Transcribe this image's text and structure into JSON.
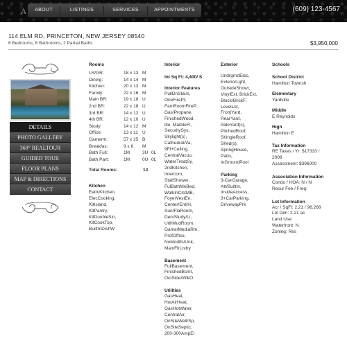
{
  "nav": {
    "logo": "A",
    "items": [
      "ABOUT",
      "LISTINGS",
      "SERVICES",
      "APPOINTMENTS"
    ],
    "phone": "(609) 123-4567"
  },
  "listing": {
    "address": "114 ELM RD, PRINCETON, NEW JERSEY 08540",
    "summary": "6 Bedrooms, 6 Bathrooms, 2 Partial Baths",
    "price": "$3,950,000"
  },
  "sidebar": {
    "items": [
      "DETAILS",
      "PHOTO GALLERY",
      "360° REALTOUR",
      "GUIDED TOUR",
      "FLOOR PLANS",
      "MAP & DIRECTIONS",
      "CONTACT"
    ],
    "active": "DETAILS"
  },
  "rooms": {
    "heading": "Rooms",
    "rows": [
      {
        "name": "LR/GR:",
        "size": "18 x 13",
        "level": "M",
        "extra": ""
      },
      {
        "name": "Dining:",
        "size": "14 x 14",
        "level": "M",
        "extra": ""
      },
      {
        "name": "Kitchen:",
        "size": "20 x 13",
        "level": "M",
        "extra": ""
      },
      {
        "name": "Family:",
        "size": "22 x 16",
        "level": "M",
        "extra": ""
      },
      {
        "name": "Main BR:",
        "size": "19 x 18",
        "level": "U",
        "extra": ""
      },
      {
        "name": "2nd BR:",
        "size": "22 x 18",
        "level": "U",
        "extra": ""
      },
      {
        "name": "3rd BR:",
        "size": "14 x 12",
        "level": "U",
        "extra": ""
      },
      {
        "name": "4th BR:",
        "size": "12 x 10",
        "level": "U",
        "extra": ""
      },
      {
        "name": "Study:",
        "size": "14 x 12",
        "level": "M",
        "extra": ""
      },
      {
        "name": "Office:",
        "size": "13 x 11",
        "level": "U",
        "extra": ""
      },
      {
        "name": "Gamerm:",
        "size": "57 x 25",
        "level": "B",
        "extra": ""
      },
      {
        "name": "Breakfas:",
        "size": "9 x 6",
        "level": "M",
        "extra": ""
      },
      {
        "name": "Bath Full:",
        "size": "1M",
        "level": "3U",
        "extra": "0L"
      },
      {
        "name": "Bath Part:",
        "size": "1M",
        "level": "0U",
        "extra": "0L"
      }
    ],
    "total_label": "Total Rooms:",
    "total_value": "13",
    "kitchen_heading": "Kitchen",
    "kitchen": [
      "EatInKitchen,",
      "ElecCooking,",
      "KitIsland,",
      "KitPantry,",
      "KitDoubleSin,",
      "KitCookTop,",
      "BuiltInDishW"
    ]
  },
  "interior": {
    "heading": "Interior",
    "sqft": "Int Sq Ft: 4,400/ S",
    "features_heading": "Interior Features",
    "features": [
      "PullDnStairs,",
      "OneFirePl,",
      "FamRoomFireP,",
      "Gas/Propane,",
      "FinishedWood,",
      "tile, MarbleFl,",
      "SecuritySys,",
      "Skylight(s),",
      "Cathedral/Va,",
      "9Ft+Ceiling,",
      "CentralVacuu,",
      "WaterTreatSy,",
      "2ndKitchen,",
      "Intercom,",
      "StallShower,",
      "FulBathMnBed,",
      "WalkInClstMB,",
      "FoyerVestEn,",
      "Center/EntrH,",
      "Sun/FlaRoom,",
      "Den/Study/Li,",
      "Util/MudRoom,",
      "Game/MediaRm,",
      "ProfOffice,",
      "NoModifs/Unk,",
      "MainFlrLndry"
    ],
    "basement_heading": "Basement",
    "basement": [
      "FullBasement,",
      "FinishedBsmt,",
      "OutSide/WlkO"
    ],
    "utilities_heading": "Utilities",
    "utilities": [
      "GasHeat,",
      "HotAirHeat,",
      "GasHotWater,",
      "CentralAir,",
      "OnSiteWell/Sp,",
      "OnSiteSeptic,",
      "200-300AmpEl"
    ]
  },
  "exterior": {
    "heading": "Exterior",
    "items": [
      "UndrgrndElec,",
      "ExteriorLght,",
      "OutsideShowr,",
      "VinylExt, BrickExt,",
      "Block/BrickF,",
      "LevelLot,",
      "FrontYard,",
      "RearYard,",
      "SideYard(s),",
      "PitchedRoof,",
      "ShingleRoof,",
      "Shed(s),",
      "SpringHouse,",
      "Patio,",
      "InGroundPool"
    ],
    "parking_heading": "Parking",
    "parking": [
      "3-CarGarage,",
      "Att/BuiltIn,",
      "InsideAccess,",
      "3+CarParking,",
      "DrivewayPrk"
    ]
  },
  "schools": {
    "heading": "Schools",
    "district_label": "School District",
    "district": "Hamilton Townsh",
    "elementary_label": "Elementary",
    "elementary": "Yardville",
    "middle_label": "Middle",
    "middle": "E Reynolds",
    "high_label": "High",
    "high": "Hamilton E"
  },
  "tax": {
    "heading": "Tax Information",
    "lines": [
      "RE Taxes / Yr: $17333 /",
      "2008",
      "Assessment: $396000"
    ]
  },
  "association": {
    "heading": "Association Information",
    "lines": [
      "Condo / HOA: N / N",
      "Recur Fee / Freq:"
    ]
  },
  "lot": {
    "heading": "Lot Information",
    "lines": [
      "Acr / SqFt: 2.21 / 96,268",
      "Lot Dim: 2.21 ac",
      "Land Use:",
      "Waterfront: N",
      "Zoning: Res"
    ]
  }
}
